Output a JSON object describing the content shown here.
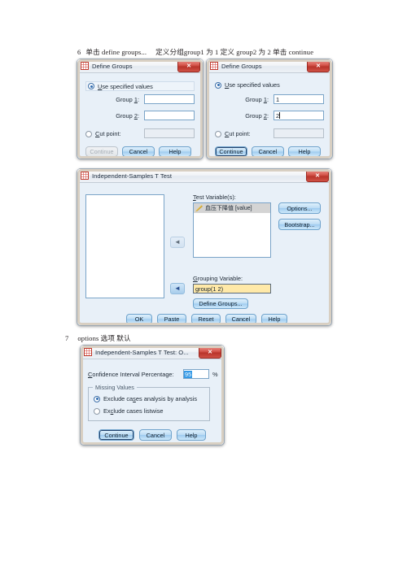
{
  "document": {
    "captions": [
      {
        "name": "caption-step-6",
        "number": "6",
        "text": "单击 define groups...",
        "text2": "定义分组group1 为 1  定义 group2 为 2  单击 continue"
      },
      {
        "name": "caption-step-7",
        "number": "7",
        "text": "options 选项  默认",
        "text2": ""
      }
    ]
  },
  "define_groups_empty": {
    "title": "Define Groups",
    "close_label": "✕",
    "use_specified_values": "Use specified values",
    "group1_label": "Group 1:",
    "group1_value": "",
    "group2_label": "Group 2:",
    "group2_value": "",
    "cut_point_label": "Cut point:",
    "cut_point_value": "",
    "buttons": {
      "continue": "Continue",
      "cancel": "Cancel",
      "help": "Help"
    }
  },
  "define_groups_filled": {
    "title": "Define Groups",
    "close_label": "✕",
    "use_specified_values": "Use specified values",
    "group1_label": "Group 1:",
    "group1_value": "1",
    "group2_label": "Group 2:",
    "group2_value": "2",
    "cut_point_label": "Cut point:",
    "cut_point_value": "",
    "buttons": {
      "continue": "Continue",
      "cancel": "Cancel",
      "help": "Help"
    }
  },
  "ttest_dialog": {
    "title": "Independent-Samples T Test",
    "close_label": "✕",
    "test_variables_label": "Test Variable(s):",
    "test_variables": [
      {
        "name": "血压下降值 [value]",
        "icon": "ruler-icon"
      }
    ],
    "grouping_variable_label": "Grouping Variable:",
    "grouping_variable_value": "group(1 2)",
    "define_groups_button": "Define Groups...",
    "side_buttons": {
      "options": "Options...",
      "bootstrap": "Bootstrap..."
    },
    "move_arrow_top": "◄",
    "move_arrow_bottom": "◄",
    "buttons": {
      "ok": "OK",
      "paste": "Paste",
      "reset": "Reset",
      "cancel": "Cancel",
      "help": "Help"
    }
  },
  "options_dialog": {
    "title": "Independent-Samples T Test: O...",
    "close_label": "✕",
    "confidence_label": "Confidence Interval Percentage:",
    "confidence_value": "95",
    "percent_sign": "%",
    "missing_values_title": "Missing Values",
    "missing_options": [
      {
        "label": "Exclude cases analysis by analysis",
        "selected": true
      },
      {
        "label": "Exclude cases listwise",
        "selected": false
      }
    ],
    "buttons": {
      "continue": "Continue",
      "cancel": "Cancel",
      "help": "Help"
    }
  },
  "colors": {
    "dialog_bg": "#e8f0f8",
    "accent_blue": "#2f6bb0",
    "close_red": "#b9342a",
    "grouping_yellow": "#ffe9a8"
  }
}
